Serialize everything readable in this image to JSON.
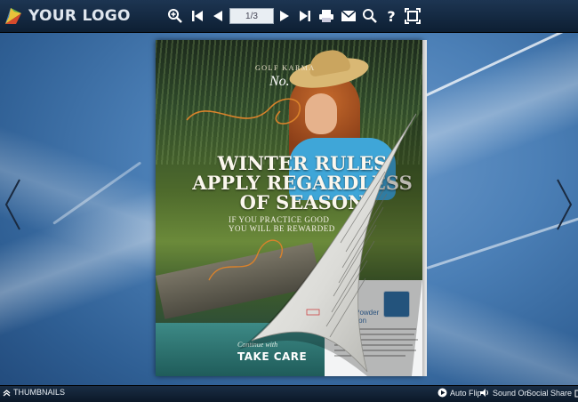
{
  "app": {
    "logo_text": "YOUR LOGO"
  },
  "toolbar": {
    "buttons": [
      {
        "name": "zoom-in-button",
        "icon": "zoom-in-icon"
      },
      {
        "name": "first-page-button",
        "icon": "first-page-icon"
      },
      {
        "name": "previous-page-button",
        "icon": "previous-icon"
      },
      {
        "name": "next-page-button",
        "icon": "next-icon"
      },
      {
        "name": "last-page-button",
        "icon": "last-page-icon"
      },
      {
        "name": "print-button",
        "icon": "print-icon"
      },
      {
        "name": "email-button",
        "icon": "email-icon"
      },
      {
        "name": "search-button",
        "icon": "search-icon"
      },
      {
        "name": "help-button",
        "icon": "help-icon"
      },
      {
        "name": "fullscreen-button",
        "icon": "fullscreen-icon"
      }
    ],
    "page_value": "1/3"
  },
  "magazine": {
    "masthead": "GOLF KARMA",
    "issue": "No.",
    "headline_1": "WINTER RULES",
    "headline_2": "APPLY REGARDLESS",
    "headline_3": "OF SEASON",
    "subhead_1": "IF YOU PRACTICE GOOD",
    "subhead_2": "YOU WILL BE REWARDED",
    "bottom_caption": "Continue with",
    "bottom_title": "TAKE CARE",
    "back_title_1": "ective Powder",
    "back_title_2": "Protection"
  },
  "bottombar": {
    "thumbnails_label": "THUMBNAILS",
    "autoflip_label": "Auto Flip",
    "sound_label": "Sound On",
    "social_label": "Social Share"
  },
  "colors": {
    "toolbar_bg": "#13273f",
    "accent_blue": "#3fa6d8",
    "text_light": "#e9eef3"
  }
}
